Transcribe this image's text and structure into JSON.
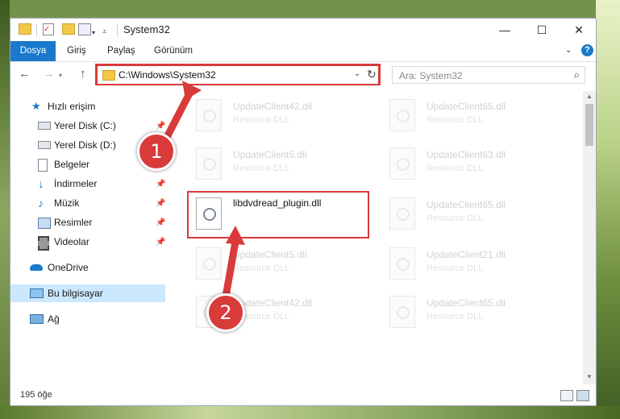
{
  "window": {
    "title": "System32",
    "controls": {
      "minimize": "—",
      "maximize": "☐",
      "close": "✕"
    }
  },
  "ribbon": {
    "tabs": [
      "Dosya",
      "Giriş",
      "Paylaş",
      "Görünüm"
    ],
    "help": "?"
  },
  "address": {
    "path": "C:\\Windows\\System32",
    "search_placeholder": "Ara: System32"
  },
  "sidebar": {
    "items": [
      {
        "label": "Hızlı erişim",
        "icon": "star-icon"
      },
      {
        "label": "Yerel Disk (C:)",
        "icon": "drive-icon"
      },
      {
        "label": "Yerel Disk (D:)",
        "icon": "drive-icon"
      },
      {
        "label": "Belgeler",
        "icon": "documents-icon"
      },
      {
        "label": "İndirmeler",
        "icon": "download-icon"
      },
      {
        "label": "Müzik",
        "icon": "music-icon"
      },
      {
        "label": "Resimler",
        "icon": "pictures-icon"
      },
      {
        "label": "Videolar",
        "icon": "video-icon"
      },
      {
        "label": "OneDrive",
        "icon": "cloud-icon"
      },
      {
        "label": "Bu bilgisayar",
        "icon": "computer-icon"
      },
      {
        "label": "Ağ",
        "icon": "network-icon"
      }
    ]
  },
  "files": [
    {
      "name": "UpdateClient42.dll",
      "type": "Resource DLL"
    },
    {
      "name": "UpdateClient65.dll",
      "type": "Resource DLL"
    },
    {
      "name": "UpdateClient5.dll",
      "type": "Resource DLL"
    },
    {
      "name": "UpdateClient63.dll",
      "type": "Resource DLL"
    },
    {
      "name": "libdvdread_plugin.dll",
      "type": ""
    },
    {
      "name": "UpdateClient65.dll",
      "type": "Resource DLL"
    },
    {
      "name": "UpdateClient5.dll",
      "type": "Resource DLL"
    },
    {
      "name": "UpdateClient21.dll",
      "type": "Resource DLL"
    },
    {
      "name": "UpdateClient42.dll",
      "type": "Resource DLL"
    },
    {
      "name": "UpdateClient65.dll",
      "type": "Resource DLL"
    }
  ],
  "status": {
    "item_count": "195 öğe"
  },
  "annotations": {
    "step1": "1",
    "step2": "2",
    "accent_color": "#d93a3a"
  }
}
